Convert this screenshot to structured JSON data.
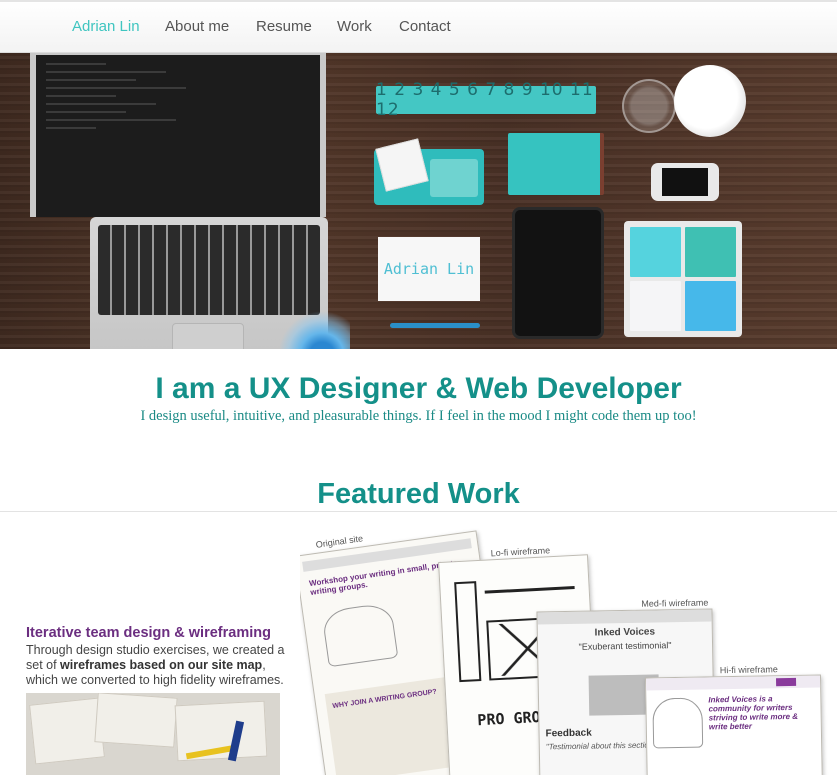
{
  "nav": {
    "brand": "Adrian Lin",
    "items": [
      "About me",
      "Resume",
      "Work",
      "Contact"
    ]
  },
  "hero": {
    "ruler_text": "1 2 3 4 5 6 7 8 9 10 11 12",
    "namecard_text": "Adrian Lin"
  },
  "intro": {
    "headline": "I am a UX Designer & Web Developer",
    "subline": "I design useful, intuitive, and pleasurable things. If I feel in the mood I might code them up too!"
  },
  "featured": {
    "heading": "Featured Work",
    "project": {
      "title": "Iterative team design & wireframing",
      "desc_1": "Through design studio exercises, we created a set of ",
      "desc_bold": "wireframes based on our site map",
      "desc_2": ", which we converted to high fidelity wireframes."
    },
    "wireframes": {
      "original": "Original site",
      "original_tagline": "Workshop your writing in small, private writing groups.",
      "original_section": "WHY JOIN A WRITING GROUP?",
      "lofi": "Lo-fi wireframe",
      "lofi_scribble": "PRO GROU",
      "medfi": "Med-fi wireframe",
      "medfi_title": "Inked Voices",
      "medfi_quote": "\"Exuberant testimonial\"",
      "medfi_feedback": "Feedback",
      "medfi_feedback_quote": "\"Testimonial about this section\"",
      "hifi": "Hi-fi wireframe",
      "hifi_tagline": "Inked Voices is a community for writers striving to write more & write better"
    }
  },
  "colors": {
    "accent": "#149089",
    "nav_active": "#3fc5c0",
    "project_title": "#6b2e80"
  }
}
